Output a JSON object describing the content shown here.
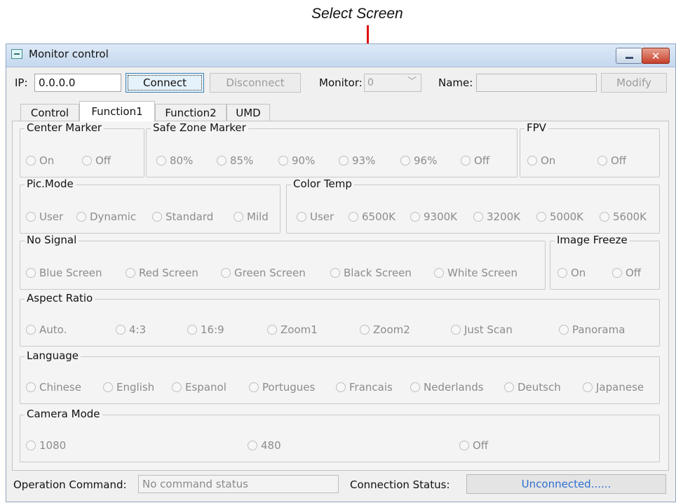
{
  "annotation": {
    "label": "Select Screen"
  },
  "window": {
    "title": "Monitor control",
    "close_glyph": "✕"
  },
  "toolbar": {
    "ip_label": "IP:",
    "ip_value": "0.0.0.0",
    "connect_label": "Connect",
    "disconnect_label": "Disconnect",
    "monitor_label": "Monitor:",
    "monitor_value": "0",
    "monitor_chevron": "﹀",
    "name_label": "Name:",
    "name_value": "",
    "modify_label": "Modify"
  },
  "tabs": [
    {
      "label": "Control"
    },
    {
      "label": "Function1",
      "active": true
    },
    {
      "label": "Function2"
    },
    {
      "label": "UMD"
    }
  ],
  "groups": {
    "center_marker": {
      "title": "Center Marker",
      "options": [
        "On",
        "Off"
      ]
    },
    "safe_zone_marker": {
      "title": "Safe Zone Marker",
      "options": [
        "80%",
        "85%",
        "90%",
        "93%",
        "96%",
        "Off"
      ]
    },
    "fpv": {
      "title": "FPV",
      "options": [
        "On",
        "Off"
      ]
    },
    "pic_mode": {
      "title": "Pic.Mode",
      "options": [
        "User",
        "Dynamic",
        "Standard",
        "Mild"
      ]
    },
    "color_temp": {
      "title": "Color Temp",
      "options": [
        "User",
        "6500K",
        "9300K",
        "3200K",
        "5000K",
        "5600K"
      ]
    },
    "no_signal": {
      "title": "No Signal",
      "options": [
        "Blue Screen",
        "Red Screen",
        "Green Screen",
        "Black Screen",
        "White Screen"
      ]
    },
    "image_freeze": {
      "title": "Image Freeze",
      "options": [
        "On",
        "Off"
      ]
    },
    "aspect_ratio": {
      "title": "Aspect Ratio",
      "options": [
        "Auto.",
        "4:3",
        "16:9",
        "Zoom1",
        "Zoom2",
        "Just Scan",
        "Panorama"
      ]
    },
    "language": {
      "title": "Language",
      "options": [
        "Chinese",
        "English",
        "Espanol",
        "Portugues",
        "Francais",
        "Nederlands",
        "Deutsch",
        "Japanese"
      ]
    },
    "camera_mode": {
      "title": "Camera Mode",
      "options": [
        "1080",
        "480",
        "Off"
      ]
    }
  },
  "status": {
    "operation_label": "Operation Command:",
    "operation_value": "No command status",
    "connection_label": "Connection Status:",
    "connection_value": "Unconnected......"
  },
  "colors": {
    "annotation": "#e01010",
    "connection_status_text": "#2f6fd0",
    "close_button": "#c7402a",
    "title_bar": "#c5d8ee"
  },
  "icons": {
    "app": "window-app-icon",
    "minimize": "minimize-icon",
    "close": "close-icon",
    "dropdown": "chevron-down-icon"
  }
}
